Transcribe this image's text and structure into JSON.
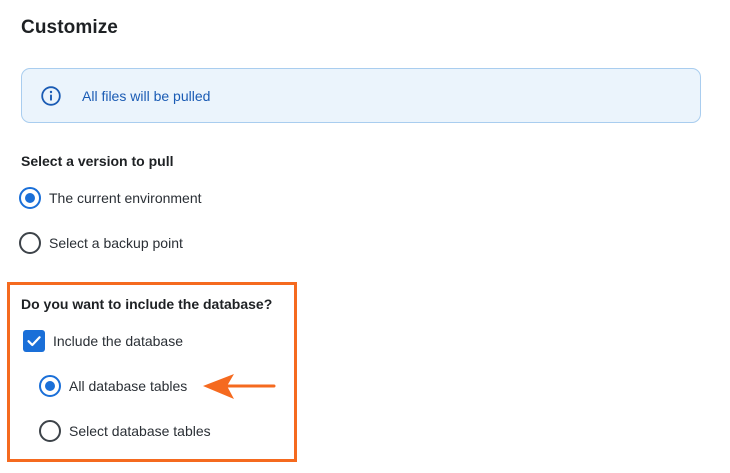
{
  "page": {
    "title": "Customize"
  },
  "info_banner": {
    "icon": "info-icon",
    "text": "All files will be pulled"
  },
  "version_section": {
    "label": "Select a version to pull",
    "options": [
      {
        "label": "The current environment",
        "selected": true
      },
      {
        "label": "Select a backup point",
        "selected": false
      }
    ]
  },
  "database_section": {
    "label": "Do you want to include the database?",
    "include_checkbox": {
      "label": "Include the database",
      "checked": true
    },
    "options": [
      {
        "label": "All database tables",
        "selected": true
      },
      {
        "label": "Select database tables",
        "selected": false
      }
    ]
  },
  "colors": {
    "accent": "#1a6fd8",
    "highlight": "#f56a1f",
    "info_bg": "#ebf4fc",
    "info_text": "#1a5bb4"
  }
}
